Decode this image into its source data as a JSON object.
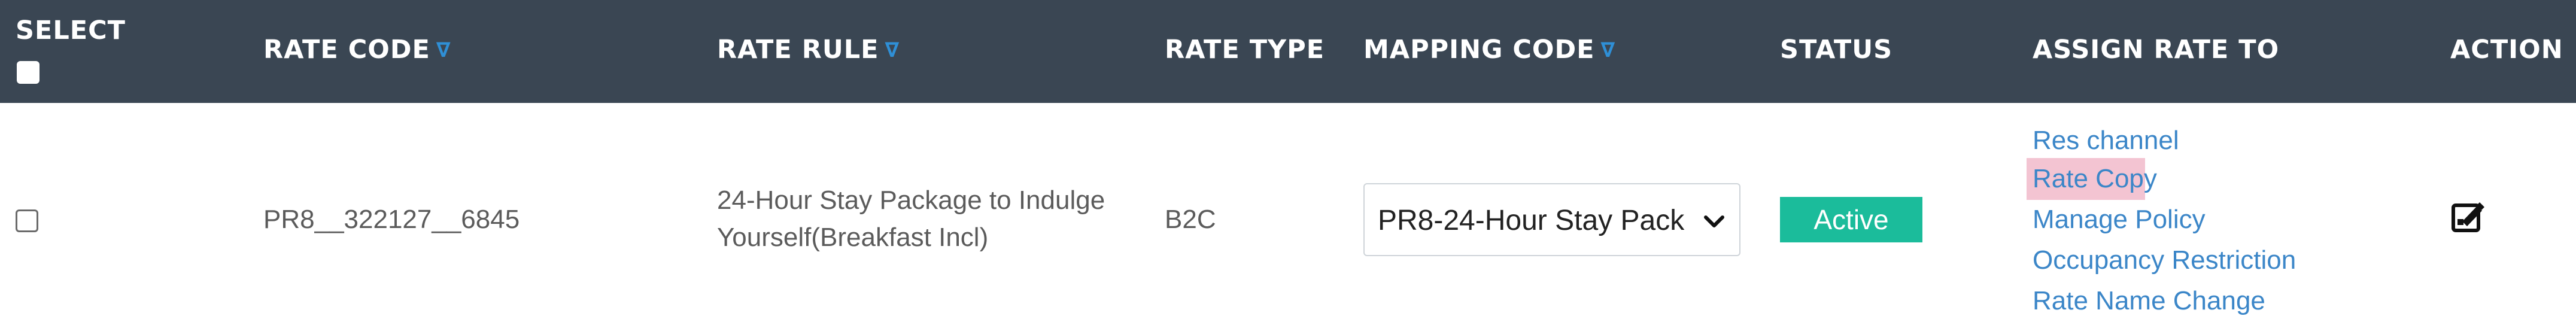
{
  "header": {
    "select": "SELECT",
    "rate_code": "RATE CODE",
    "rate_rule": "RATE RULE",
    "rate_type": "RATE TYPE",
    "mapping_code": "MAPPING CODE",
    "status": "STATUS",
    "assign_rate_to": "ASSIGN RATE TO",
    "action": "ACTION",
    "filter_glyph": "∇"
  },
  "rows": [
    {
      "rate_code": "PR8__322127__6845",
      "rate_rule_line1": "24-Hour Stay Package to Indulge",
      "rate_rule_line2": "Yourself(Breakfast Incl)",
      "rate_type": "B2C",
      "mapping_code": "PR8-24-Hour Stay Pack",
      "status": "Active",
      "assign_links": [
        "Res channel",
        "Rate Copy",
        "Manage Policy",
        "Occupancy Restriction",
        "Rate Name Change"
      ]
    }
  ],
  "colors": {
    "header_bg": "#3a4653",
    "filter_icon": "#2f8fd6",
    "status_active": "#1bbc9b",
    "link": "#3b86c8",
    "highlight": "#f3c4d2"
  },
  "icons": {
    "filter": "filter-icon",
    "dropdown": "chevron-down-icon",
    "action": "edit-icon"
  }
}
